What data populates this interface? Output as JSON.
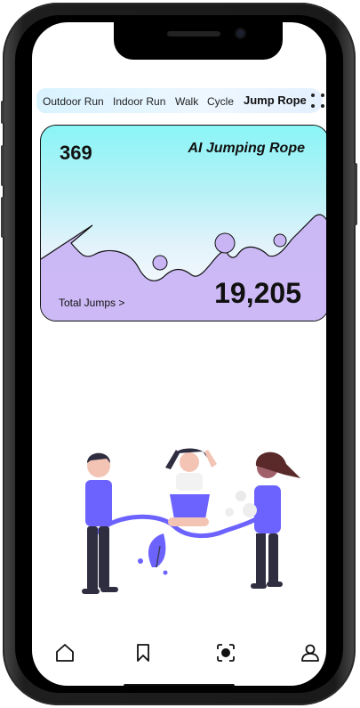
{
  "tabs": [
    {
      "label": "Outdoor Run",
      "active": false
    },
    {
      "label": "Indoor Run",
      "active": false
    },
    {
      "label": "Walk",
      "active": false
    },
    {
      "label": "Cycle",
      "active": false
    },
    {
      "label": "Jump Rope",
      "active": true
    }
  ],
  "menu_icon": "four-dots-icon",
  "card": {
    "count": "369",
    "title": "AI Jumping Rope",
    "total_value": "19,205",
    "total_label": "Total Jumps >",
    "gradient_top": "#8af5f5",
    "wave_fill": "#c9b5f4"
  },
  "illustration": "children-jumping-rope-illustration",
  "accent": "#6c63ff",
  "nav": [
    {
      "icon": "home-icon"
    },
    {
      "icon": "bookmark-icon"
    },
    {
      "icon": "record-icon"
    },
    {
      "icon": "profile-icon"
    }
  ]
}
